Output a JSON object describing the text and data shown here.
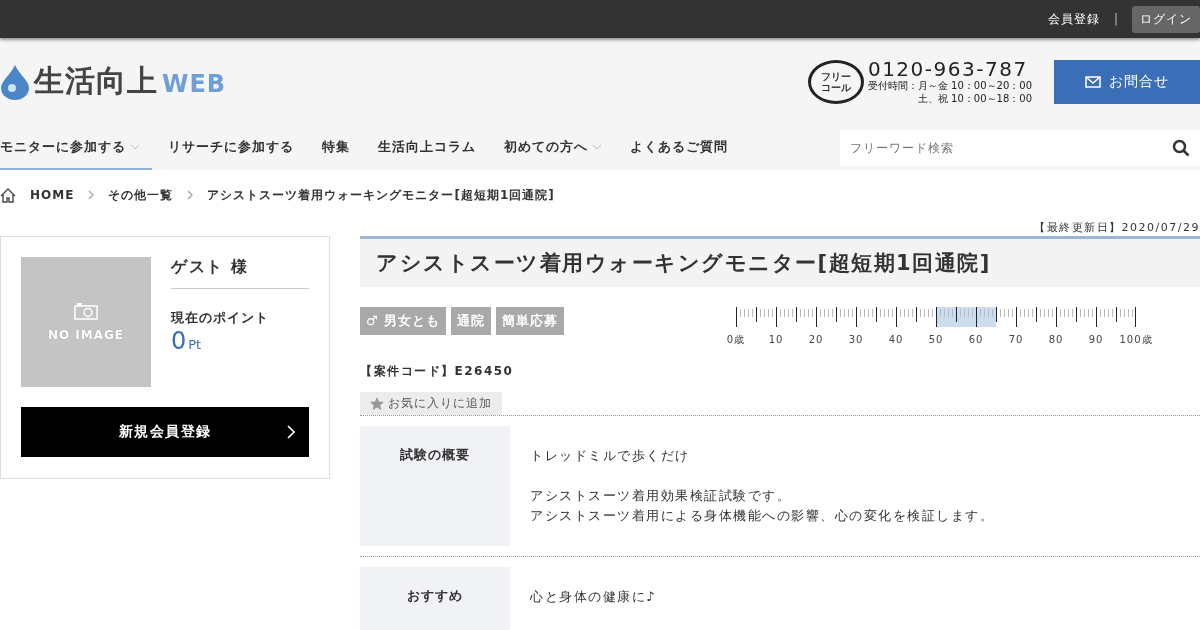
{
  "top_bar": {
    "register_link": "会員登録",
    "separator": "|",
    "login_button": "ログイン"
  },
  "header": {
    "logo_text": "生活向上",
    "logo_suffix": "WEB",
    "phone_badge": [
      "フリー",
      "コール"
    ],
    "phone": "0120-963-787",
    "hours": [
      "受付時間：月～金 10：00～20：00",
      "土、祝 10：00～18：00"
    ],
    "contact_button": "お問合せ"
  },
  "nav": {
    "items": [
      {
        "label": "モニターに参加する",
        "has_dropdown": true,
        "selected": true
      },
      {
        "label": "リサーチに参加する",
        "has_dropdown": false,
        "selected": false
      },
      {
        "label": "特集",
        "has_dropdown": false,
        "selected": false
      },
      {
        "label": "生活向上コラム",
        "has_dropdown": false,
        "selected": false
      },
      {
        "label": "初めての方へ",
        "has_dropdown": true,
        "selected": false
      },
      {
        "label": "よくあるご質問",
        "has_dropdown": false,
        "selected": false
      }
    ],
    "search": {
      "placeholder": "フリーワード検索"
    }
  },
  "breadcrumb": [
    "HOME",
    "その他一覧",
    "アシストスーツ着用ウォーキングモニター[超短期1回通院]"
  ],
  "user_card": {
    "image_label": "NO IMAGE",
    "name": "ゲスト 様",
    "points_label": "現在のポイント",
    "points": "0",
    "points_unit": "Pt",
    "register_button": "新規会員登録"
  },
  "article": {
    "updated": "【最終更新日】2020/07/29",
    "title": "アシストスーツ着用ウォーキングモニター[超短期1回通院]",
    "tags": [
      {
        "label": "男女とも",
        "icon": "♂"
      },
      {
        "label": "通院"
      },
      {
        "label": "簡単応募"
      }
    ],
    "age_ruler": {
      "labels": [
        "0歳",
        "10",
        "20",
        "30",
        "40",
        "50",
        "60",
        "70",
        "80",
        "90",
        "100歳"
      ],
      "segments": [
        {
          "selected": false
        },
        {
          "selected": false
        },
        {
          "selected": false
        },
        {
          "selected": false
        },
        {
          "selected": false
        },
        {
          "selected": false
        },
        {
          "selected": false
        },
        {
          "selected": false
        },
        {
          "selected": false
        },
        {
          "selected": false
        },
        {
          "selected": true
        },
        {
          "selected": true
        },
        {
          "selected": true
        },
        {
          "selected": false
        },
        {
          "selected": false
        },
        {
          "selected": false
        },
        {
          "selected": false
        },
        {
          "selected": false
        },
        {
          "selected": false
        },
        {
          "selected": false
        }
      ]
    },
    "code": "【案件コード】E26450",
    "favorite_button": "お気に入りに追加",
    "details": [
      {
        "heading": "試験の概要",
        "paragraphs": [
          [
            "トレッドミルで歩くだけ"
          ],
          [
            "アシストスーツ着用効果検証試験です。",
            "アシストスーツ着用による身体機能への影響、心の変化を検証します。"
          ]
        ]
      },
      {
        "heading": "おすすめ",
        "paragraphs": [
          [
            "心と身体の健康に♪"
          ]
        ]
      }
    ]
  }
}
